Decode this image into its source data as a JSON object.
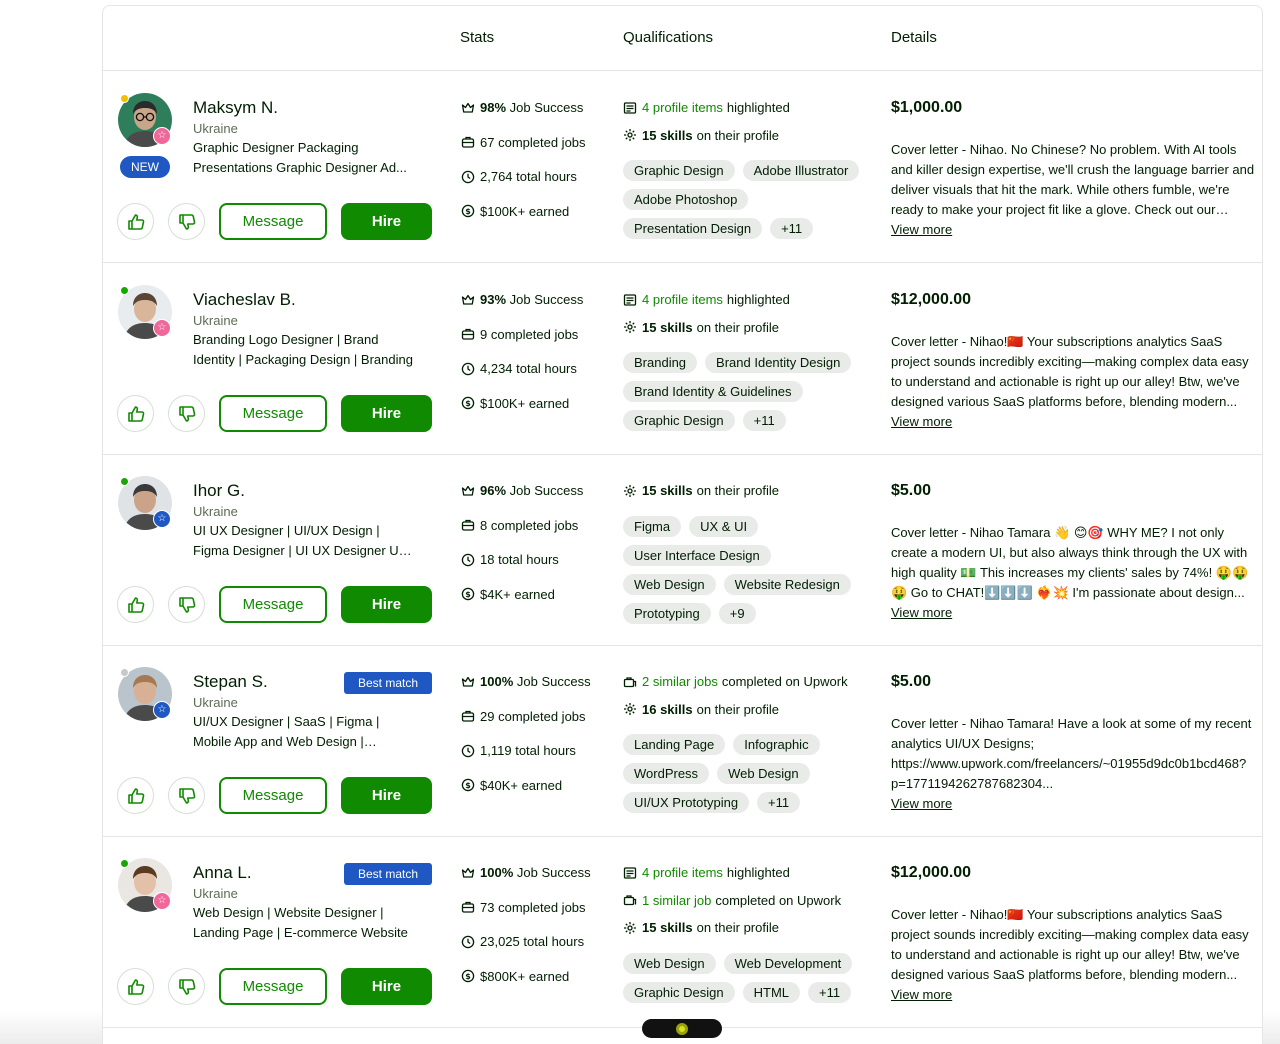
{
  "header": {
    "stats_label": "Stats",
    "qualifications_label": "Qualifications",
    "details_label": "Details"
  },
  "actions": {
    "message_label": "Message",
    "hire_label": "Hire",
    "view_more_label": "View more"
  },
  "colors": {
    "brand_green": "#108a00",
    "badge_blue": "#1f57c3",
    "online": "#14a800",
    "away": "#f0c000",
    "offline": "#c8c8c8"
  },
  "freelancers": [
    {
      "name": "Maksym N.",
      "country": "Ukraine",
      "title": "Graphic Designer Packaging Presentations Graphic Designer Ad...",
      "new_badge": "NEW",
      "status": "away",
      "badge_icon": "pink-star-badge-icon",
      "stats": {
        "job_success_value": "98%",
        "job_success_label": "Job Success",
        "jobs_value": "67",
        "jobs_label": "completed jobs",
        "hours_value": "2,764",
        "hours_label": "total hours",
        "earned_value": "$100K+",
        "earned_label": "earned"
      },
      "qual_lines": [
        {
          "icon": "portfolio-icon",
          "green": "4 profile items",
          "bold": "",
          "rest": "highlighted"
        },
        {
          "icon": "skills-icon",
          "green": "",
          "bold": "15 skills",
          "rest": "on their profile"
        }
      ],
      "tags": [
        "Graphic Design",
        "Adobe Illustrator",
        "Adobe Photoshop",
        "Presentation Design",
        "+11"
      ],
      "price": "$1,000.00",
      "cover": "Cover letter - Nihao. No Chinese? No problem. With AI tools and killer design expertise, we'll crush the language barrier and deliver visuals that hit the mark. While others fumble, we're ready to make your project fit like a glove. Check out our work:..."
    },
    {
      "name": "Viacheslav B.",
      "country": "Ukraine",
      "title": "Branding Logo Designer | Brand Identity | Packaging Design | Branding",
      "status": "online",
      "badge_icon": "pink-star-badge-icon",
      "stats": {
        "job_success_value": "93%",
        "job_success_label": "Job Success",
        "jobs_value": "9",
        "jobs_label": "completed jobs",
        "hours_value": "4,234",
        "hours_label": "total hours",
        "earned_value": "$100K+",
        "earned_label": "earned"
      },
      "qual_lines": [
        {
          "icon": "portfolio-icon",
          "green": "4 profile items",
          "bold": "",
          "rest": "highlighted"
        },
        {
          "icon": "skills-icon",
          "green": "",
          "bold": "15 skills",
          "rest": "on their profile"
        }
      ],
      "tags": [
        "Branding",
        "Brand Identity Design",
        "Brand Identity & Guidelines",
        "Graphic Design",
        "+11"
      ],
      "price": "$12,000.00",
      "cover": "Cover letter - Nihao!🇨🇳 Your subscriptions analytics SaaS project sounds incredibly exciting—making complex data easy to understand and actionable is right up our alley! Btw, we've designed various SaaS platforms before, blending modern..."
    },
    {
      "name": "Ihor G.",
      "country": "Ukraine",
      "title": "UI UX Designer | UI/UX Design | Figma Designer | UI UX Designer UX UI",
      "status": "online",
      "badge_icon": "blue-star-badge-icon",
      "stats": {
        "job_success_value": "96%",
        "job_success_label": "Job Success",
        "jobs_value": "8",
        "jobs_label": "completed jobs",
        "hours_value": "18",
        "hours_label": "total hours",
        "earned_value": "$4K+",
        "earned_label": "earned"
      },
      "qual_lines": [
        {
          "icon": "skills-icon",
          "green": "",
          "bold": "15 skills",
          "rest": "on their profile"
        }
      ],
      "tags": [
        "Figma",
        "UX & UI",
        "User Interface Design",
        "Web Design",
        "Website Redesign",
        "Prototyping",
        "+9"
      ],
      "price": "$5.00",
      "cover": "Cover letter - Nihao Tamara 👋 😊🎯 WHY ME? I not only create a modern UI, but also always think through the UX with high quality 💵 This increases my clients' sales by 74%! 🤑🤑🤑 Go to CHAT!⬇️⬇️⬇️ ❤️‍🔥💥 I'm passionate about design..."
    },
    {
      "name": "Stepan S.",
      "country": "Ukraine",
      "title": "UI/UX Designer | SaaS | Figma | Mobile App and Web Design | Platforms",
      "best_match": "Best match",
      "status": "offline",
      "badge_icon": "blue-star-badge-icon",
      "stats": {
        "job_success_value": "100%",
        "job_success_label": "Job Success",
        "jobs_value": "29",
        "jobs_label": "completed jobs",
        "hours_value": "1,119",
        "hours_label": "total hours",
        "earned_value": "$40K+",
        "earned_label": "earned"
      },
      "qual_lines": [
        {
          "icon": "similar-jobs-icon",
          "green": "2 similar jobs",
          "bold": "",
          "rest": "completed on Upwork"
        },
        {
          "icon": "skills-icon",
          "green": "",
          "bold": "16 skills",
          "rest": "on their profile"
        }
      ],
      "tags": [
        "Landing Page",
        "Infographic",
        "WordPress",
        "Web Design",
        "UI/UX Prototyping",
        "+11"
      ],
      "price": "$5.00",
      "cover": "Cover letter - Nihao Tamara! Have a look at some of my recent analytics UI/UX Designs; https://www.upwork.com/freelancers/~01955d9dc0b1bcd468?p=1771194262787682304..."
    },
    {
      "name": "Anna L.",
      "country": "Ukraine",
      "title": "Web Design | Website Designer | Landing Page | E-commerce Website",
      "best_match": "Best match",
      "status": "online",
      "badge_icon": "pink-star-badge-icon",
      "stats": {
        "job_success_value": "100%",
        "job_success_label": "Job Success",
        "jobs_value": "73",
        "jobs_label": "completed jobs",
        "hours_value": "23,025",
        "hours_label": "total hours",
        "earned_value": "$800K+",
        "earned_label": "earned"
      },
      "qual_lines": [
        {
          "icon": "portfolio-icon",
          "green": "4 profile items",
          "bold": "",
          "rest": "highlighted"
        },
        {
          "icon": "similar-jobs-icon",
          "green": "1 similar job",
          "bold": "",
          "rest": "completed on Upwork"
        },
        {
          "icon": "skills-icon",
          "green": "",
          "bold": "15 skills",
          "rest": "on their profile"
        }
      ],
      "tags": [
        "Web Design",
        "Web Development",
        "Graphic Design",
        "HTML",
        "+11"
      ],
      "price": "$12,000.00",
      "cover": "Cover letter - Nihao!🇨🇳 Your subscriptions analytics SaaS project sounds incredibly exciting—making complex data easy to understand and actionable is right up our alley! Btw, we've designed various SaaS platforms before, blending modern..."
    }
  ]
}
